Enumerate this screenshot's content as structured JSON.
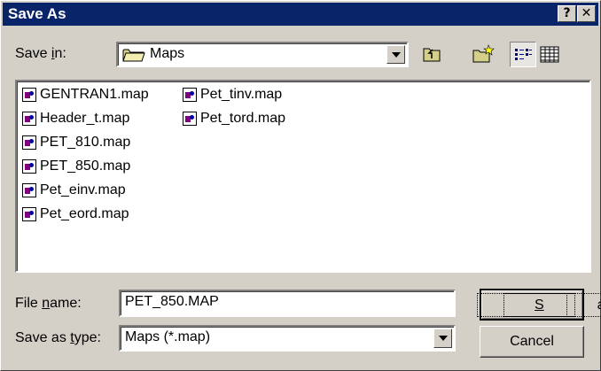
{
  "window": {
    "title": "Save As",
    "help_glyph": "?",
    "close_glyph": "✕"
  },
  "save_in": {
    "label_pre": "Save ",
    "label_u": "i",
    "label_post": "n:",
    "value": "Maps",
    "icon": "folder-icon"
  },
  "toolbar": {
    "up_icon": "up-one-level-icon",
    "new_folder_icon": "new-folder-icon",
    "list_icon": "list-view-icon",
    "details_icon": "details-view-icon"
  },
  "files": [
    "GENTRAN1.map",
    "Header_t.map",
    "PET_810.map",
    "PET_850.map",
    "Pet_einv.map",
    "Pet_eord.map",
    "Pet_tinv.map",
    "Pet_tord.map"
  ],
  "file_name": {
    "label_pre": "File ",
    "label_u": "n",
    "label_post": "ame:",
    "value": "PET_850.MAP"
  },
  "save_type": {
    "label_pre": "Save as ",
    "label_u": "t",
    "label_post": "ype:",
    "value": "Maps (*.map)"
  },
  "buttons": {
    "save_u": "S",
    "save_rest": "ave",
    "cancel": "Cancel"
  }
}
